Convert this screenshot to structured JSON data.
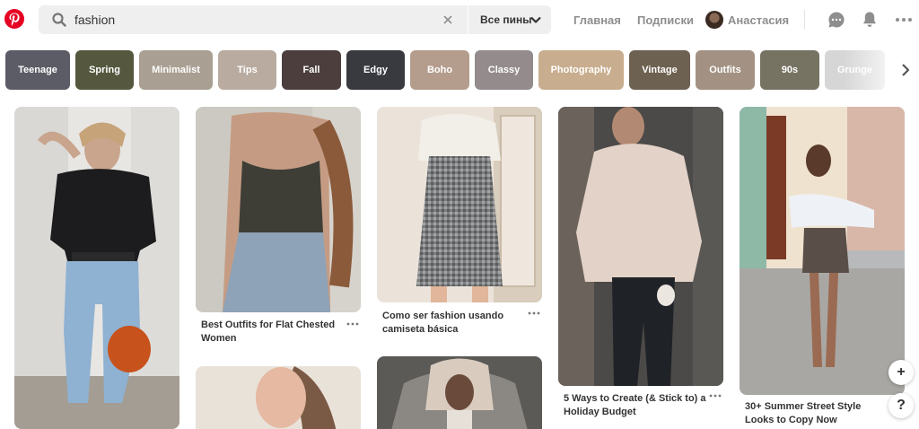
{
  "header": {
    "logo_icon": "pinterest-logo-icon",
    "search": {
      "value": "fashion",
      "placeholder": ""
    },
    "scope_label": "Все пины",
    "nav": {
      "home": "Главная",
      "subscriptions": "Подписки"
    },
    "profile_name": "Анастасия",
    "icons": [
      "messages-icon",
      "notifications-bell-icon",
      "more-options-icon"
    ]
  },
  "tags": [
    {
      "label": "Teenage",
      "color": "#5c5c66"
    },
    {
      "label": "Spring",
      "color": "#55583f"
    },
    {
      "label": "Minimalist",
      "color": "#a99f92"
    },
    {
      "label": "Tips",
      "color": "#b9aba0"
    },
    {
      "label": "Fall",
      "color": "#4b3e3c"
    },
    {
      "label": "Edgy",
      "color": "#383a40"
    },
    {
      "label": "Boho",
      "color": "#b49d8d"
    },
    {
      "label": "Classy",
      "color": "#938b8c"
    },
    {
      "label": "Photography",
      "color": "#c8ad8e"
    },
    {
      "label": "Vintage",
      "color": "#6d6151"
    },
    {
      "label": "Outfits",
      "color": "#a39283"
    },
    {
      "label": "90s",
      "color": "#767362"
    },
    {
      "label": "Grunge",
      "color": "#d6d6d6"
    }
  ],
  "pins": [
    {
      "title": ""
    },
    {
      "title": "Best Outfits for Flat Chested Women"
    },
    {
      "title": "Como ser fashion usando camiseta básica"
    },
    {
      "title": "5 Ways to Create (& Stick to) a Holiday Budget"
    },
    {
      "title": "30+ Summer Street Style Looks to Copy Now"
    },
    {
      "title": ""
    },
    {
      "title": ""
    }
  ],
  "fab": {
    "add": "+",
    "help": "?"
  }
}
